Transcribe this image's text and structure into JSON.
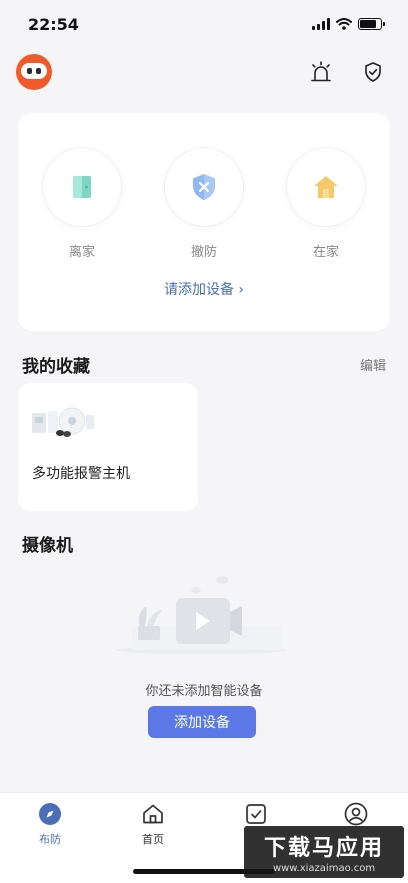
{
  "status_bar": {
    "time": "22:54"
  },
  "modes": [
    {
      "label": "离家",
      "icon": "door-icon",
      "color": "#7ed6c4"
    },
    {
      "label": "撤防",
      "icon": "shield-x-icon",
      "color": "#8fb8ee"
    },
    {
      "label": "在家",
      "icon": "house-icon",
      "color": "#f5c96a"
    }
  ],
  "mode_card": {
    "add_device_link": "请添加设备 ›"
  },
  "favorites": {
    "title": "我的收藏",
    "edit": "编辑",
    "items": [
      {
        "label": "多功能报警主机"
      }
    ]
  },
  "cameras": {
    "title": "摄像机",
    "empty_text": "你还未添加智能设备",
    "add_button": "添加设备"
  },
  "tabbar": {
    "tabs": [
      {
        "label": "布防",
        "icon": "compass-icon",
        "active": true
      },
      {
        "label": "首页",
        "icon": "home-icon",
        "active": false
      },
      {
        "label": "",
        "icon": "checkbox-icon",
        "active": false
      },
      {
        "label": "",
        "icon": "user-icon",
        "active": false
      }
    ]
  },
  "watermark": {
    "title": "下载马应用",
    "url": "www.xiazaimao.com"
  },
  "colors": {
    "accent": "#5b78e6",
    "link": "#4a6fb8"
  }
}
